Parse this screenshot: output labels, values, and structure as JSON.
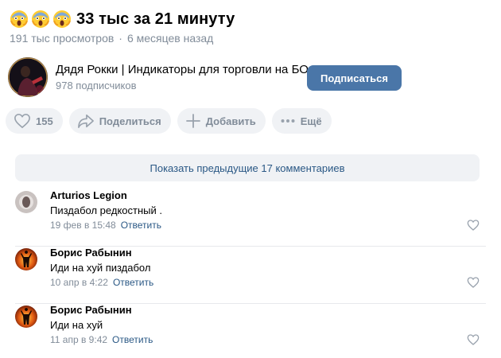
{
  "video": {
    "title": "33 тыс за 21 минуту",
    "views": "191 тыс просмотров",
    "separator": "·",
    "age": "6 месяцев назад",
    "title_emoji": [
      "screaming-face-icon",
      "screaming-face-icon",
      "screaming-face-icon"
    ]
  },
  "channel": {
    "name": "Дядя Рокки | Индикаторы для торговли на БО",
    "subscribers": "978 подписчиков",
    "subscribe_label": "Подписаться",
    "accent": "#4a76a8"
  },
  "actions": {
    "like_count": "155",
    "share_label": "Поделиться",
    "add_label": "Добавить",
    "more_label": "Ещё"
  },
  "comments_section": {
    "show_previous_label": "Показать предыдущие 17 комментариев",
    "reply_label": "Ответить",
    "items": [
      {
        "author": "Arturios Legion",
        "text": "Пиздабол редкостный .",
        "date": "19 фев в 15:48"
      },
      {
        "author": "Борис Рабынин",
        "text": "Иди на хуй пиздабол",
        "date": "10 апр в 4:22"
      },
      {
        "author": "Борис Рабынин",
        "text": "Иди на хуй",
        "date": "11 апр в 9:42"
      }
    ]
  }
}
